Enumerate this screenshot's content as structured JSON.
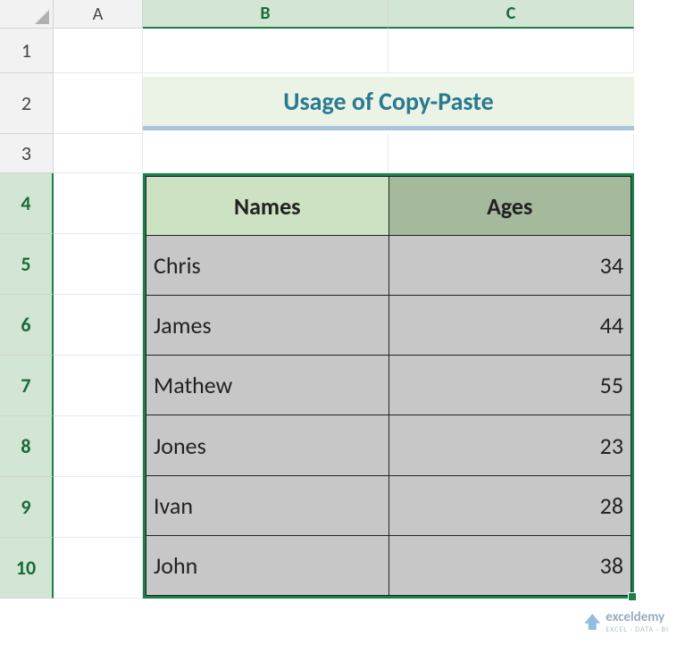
{
  "columns": {
    "A": "A",
    "B": "B",
    "C": "C"
  },
  "rows": [
    "1",
    "2",
    "3",
    "4",
    "5",
    "6",
    "7",
    "8",
    "9",
    "10"
  ],
  "title": "Usage of Copy-Paste",
  "table": {
    "headers": {
      "names": "Names",
      "ages": "Ages"
    },
    "rows": [
      {
        "name": "Chris",
        "age": "34"
      },
      {
        "name": "James",
        "age": "44"
      },
      {
        "name": "Mathew",
        "age": "55"
      },
      {
        "name": "Jones",
        "age": "23"
      },
      {
        "name": "Ivan",
        "age": "28"
      },
      {
        "name": "John",
        "age": "38"
      }
    ]
  },
  "watermark": {
    "brand": "exceldemy",
    "sub": "EXCEL · DATA · BI"
  },
  "chart_data": {
    "type": "table",
    "title": "Usage of Copy-Paste",
    "columns": [
      "Names",
      "Ages"
    ],
    "rows": [
      [
        "Chris",
        34
      ],
      [
        "James",
        44
      ],
      [
        "Mathew",
        55
      ],
      [
        "Jones",
        23
      ],
      [
        "Ivan",
        28
      ],
      [
        "John",
        38
      ]
    ]
  }
}
